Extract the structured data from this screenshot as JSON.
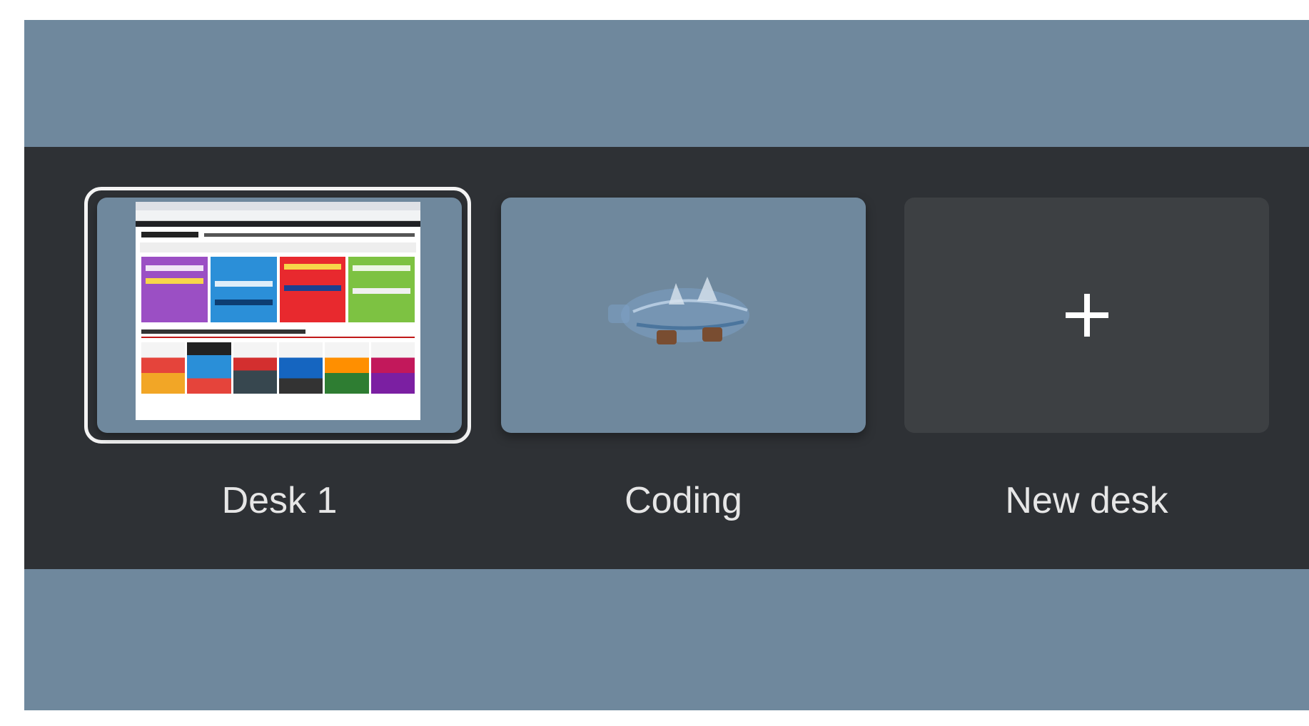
{
  "desks": [
    {
      "label": "Desk 1",
      "active": true,
      "preview": "browser-window"
    },
    {
      "label": "Coding",
      "active": false,
      "preview": "wallpaper-bottle"
    }
  ],
  "new_desk": {
    "label": "New desk",
    "icon": "plus-icon"
  },
  "colors": {
    "wallpaper": "#6f889d",
    "desk_bar": "#2e3135",
    "new_desk_tile": "#3d4043",
    "active_ring": "#f4f4f4",
    "label_text": "#e6e6e6"
  },
  "mini_window_tiles": [
    "#9b4fc4",
    "#2b8fd8",
    "#e8292e",
    "#7dc242"
  ]
}
